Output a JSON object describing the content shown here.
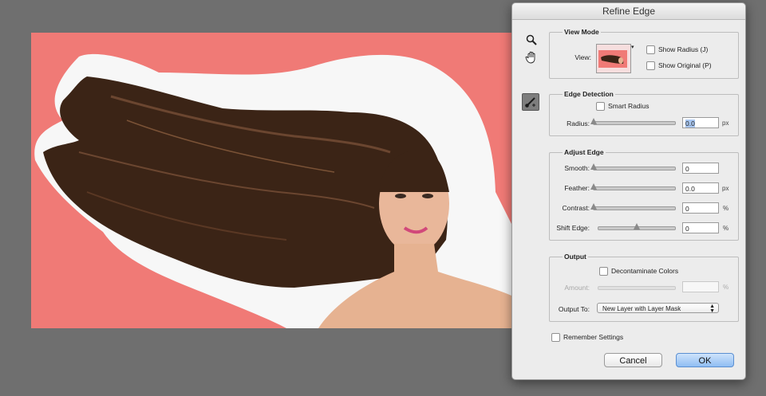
{
  "dialog": {
    "title": "Refine Edge",
    "tools": [
      "zoom-icon",
      "hand-icon",
      "refine-radius-brush-icon"
    ],
    "view_mode": {
      "title": "View Mode",
      "view_label": "View:",
      "show_radius_label": "Show Radius (J)",
      "show_original_label": "Show Original (P)",
      "show_radius_checked": false,
      "show_original_checked": false
    },
    "edge_detection": {
      "title": "Edge Detection",
      "smart_radius_label": "Smart Radius",
      "smart_radius_checked": false,
      "radius_label": "Radius:",
      "radius_value": "0.0",
      "radius_unit": "px",
      "radius_level": 0
    },
    "adjust_edge": {
      "title": "Adjust Edge",
      "smooth_label": "Smooth:",
      "smooth_value": "0",
      "smooth_level": 0,
      "feather_label": "Feather:",
      "feather_value": "0.0",
      "feather_unit": "px",
      "feather_level": 0,
      "contrast_label": "Contrast:",
      "contrast_value": "0",
      "contrast_unit": "%",
      "contrast_level": 0,
      "shift_label": "Shift Edge:",
      "shift_value": "0",
      "shift_unit": "%",
      "shift_level": 0.5
    },
    "output": {
      "title": "Output",
      "decontaminate_label": "Decontaminate Colors",
      "decontaminate_checked": false,
      "amount_label": "Amount:",
      "amount_value": "",
      "amount_unit": "%",
      "output_to_label": "Output To:",
      "output_to_value": "New Layer with Layer Mask"
    },
    "remember_label": "Remember Settings",
    "remember_checked": false,
    "cancel_label": "Cancel",
    "ok_label": "OK"
  },
  "colors": {
    "workspace": "#6f6f6f",
    "overlay": "#f07a76",
    "accent": "#8fbdf3"
  }
}
